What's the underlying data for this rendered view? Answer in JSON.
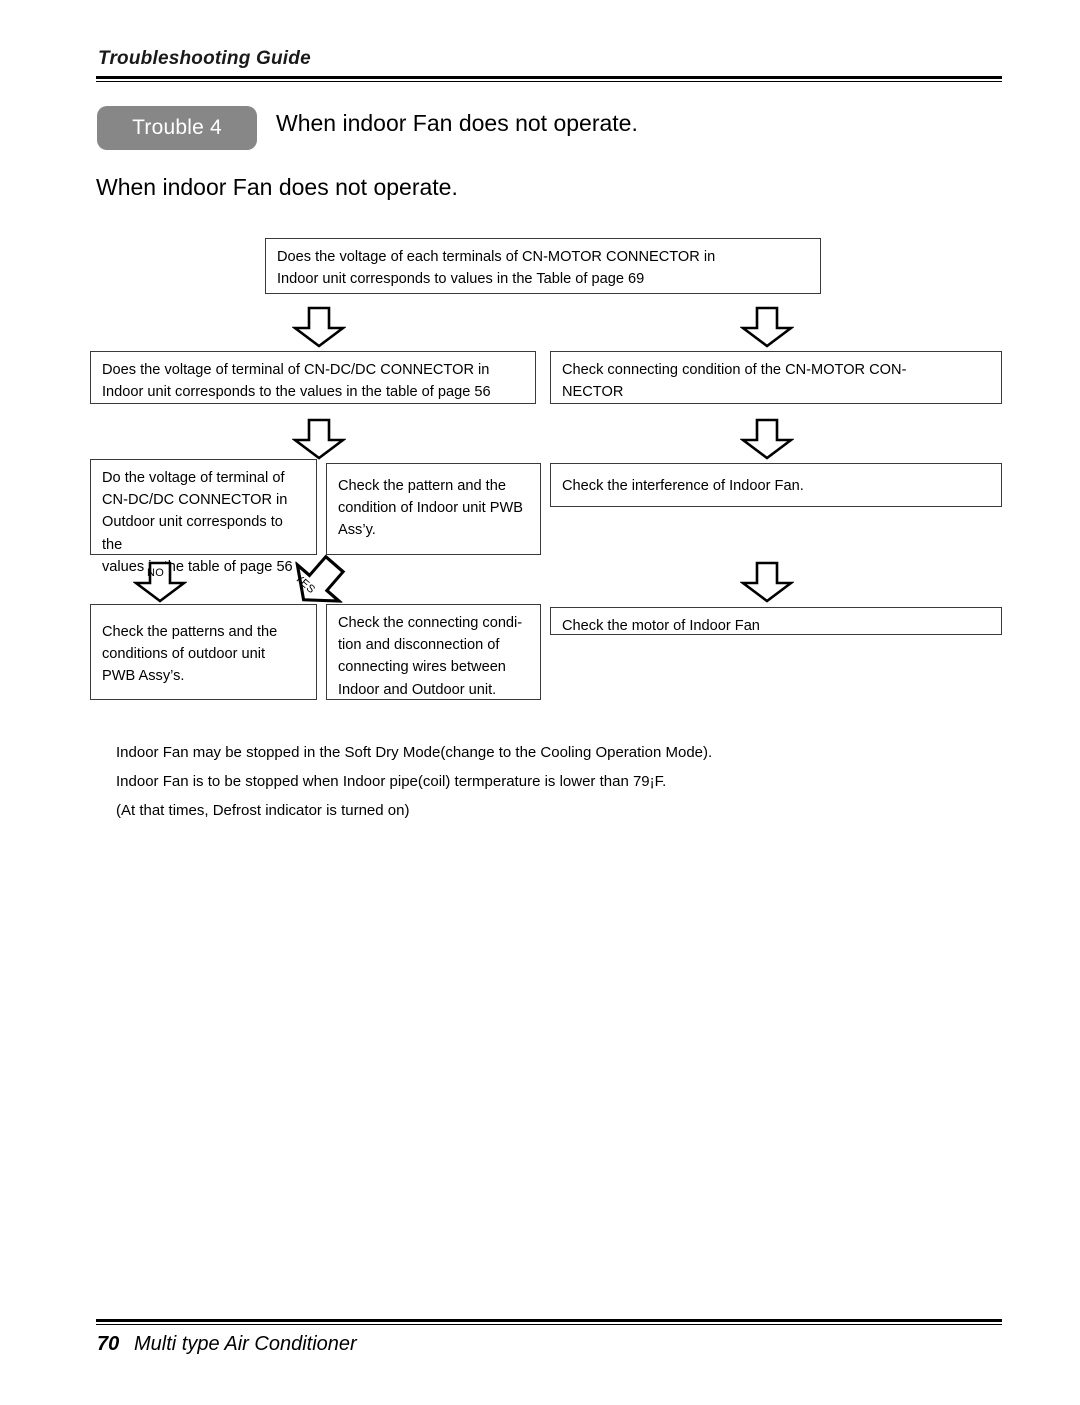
{
  "header": {
    "guide_title": "Troubleshooting Guide"
  },
  "trouble": {
    "badge_label": "Trouble 4",
    "badge_color": "#878787",
    "badge_text_color": "#ffffff",
    "title": "When indoor Fan does not operate.",
    "section_heading": "When indoor Fan does not operate."
  },
  "flow": {
    "boxes": [
      {
        "id": "root-question",
        "line1": "Does the voltage of each terminals of CN-MOTOR CONNECTOR in",
        "line2": "Indoor unit corresponds to values in the Table of page 69"
      },
      {
        "id": "left-dcdc-indoor",
        "line1": "Does the voltage of terminal of CN-DC/DC CONNECTOR in",
        "line2": "Indoor unit corresponds to the values in the table of page 56"
      },
      {
        "id": "right-check-connecting",
        "line1": "Check connecting condition of the CN-MOTOR CON-",
        "line2": "NECTOR"
      },
      {
        "id": "left-dcdc-outdoor",
        "line1": "Do the voltage of terminal of",
        "line2": "CN-DC/DC CONNECTOR in",
        "line3": "Outdoor unit corresponds to the",
        "line4": "values in the table of page 56"
      },
      {
        "id": "mid-check-pattern",
        "line1": "Check the pattern and the",
        "line2": "condition of Indoor unit PWB",
        "line3": "Ass’y."
      },
      {
        "id": "right-check-interference",
        "line1": "Check the interference of Indoor Fan."
      },
      {
        "id": "left-check-patterns",
        "line1": "Check the patterns and the",
        "line2": "conditions of outdoor unit",
        "line3": "PWB Assy’s."
      },
      {
        "id": "mid-check-wires",
        "line1": "Check the connecting condi-",
        "line2": "tion and disconnection of",
        "line3": "connecting wires between",
        "line4": "Indoor and Outdoor unit."
      },
      {
        "id": "right-check-motor",
        "line1": "Check the motor of Indoor Fan"
      }
    ],
    "arrow_labels": {
      "no": "NO",
      "yes": "YES"
    }
  },
  "notes": {
    "line1": "Indoor Fan may be stopped in the Soft Dry Mode(change to the Cooling Operation Mode).",
    "line2": "Indoor Fan is to be stopped when Indoor pipe(coil) termperature is lower than 79¡F.",
    "line3": "(At that times, Defrost indicator is turned on)"
  },
  "footer": {
    "page_number": "70",
    "product": "Multi type Air Conditioner"
  }
}
